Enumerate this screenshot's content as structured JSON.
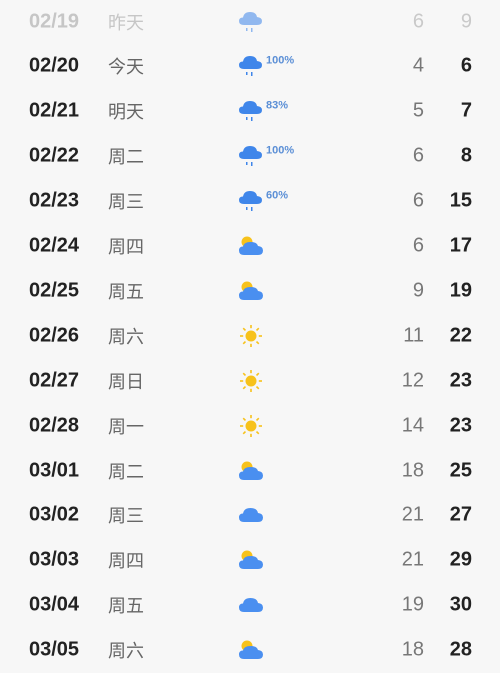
{
  "colors": {
    "rain_cloud": "#3f86ea",
    "cloud": "#4a8ff0",
    "sun": "#f7c21b",
    "precip_text": "#5b8fd6"
  },
  "forecast": [
    {
      "date": "02/19",
      "day": "昨天",
      "icon": "rain-icon",
      "precip": "",
      "low": "6",
      "high": "9",
      "past": true
    },
    {
      "date": "02/20",
      "day": "今天",
      "icon": "rain-icon",
      "precip": "100%",
      "low": "4",
      "high": "6",
      "past": false
    },
    {
      "date": "02/21",
      "day": "明天",
      "icon": "rain-icon",
      "precip": "83%",
      "low": "5",
      "high": "7",
      "past": false
    },
    {
      "date": "02/22",
      "day": "周二",
      "icon": "rain-icon",
      "precip": "100%",
      "low": "6",
      "high": "8",
      "past": false
    },
    {
      "date": "02/23",
      "day": "周三",
      "icon": "rain-icon",
      "precip": "60%",
      "low": "6",
      "high": "15",
      "past": false
    },
    {
      "date": "02/24",
      "day": "周四",
      "icon": "partly-cloudy-icon",
      "precip": "",
      "low": "6",
      "high": "17",
      "past": false
    },
    {
      "date": "02/25",
      "day": "周五",
      "icon": "partly-cloudy-icon",
      "precip": "",
      "low": "9",
      "high": "19",
      "past": false
    },
    {
      "date": "02/26",
      "day": "周六",
      "icon": "sun-icon",
      "precip": "",
      "low": "11",
      "high": "22",
      "past": false
    },
    {
      "date": "02/27",
      "day": "周日",
      "icon": "sun-icon",
      "precip": "",
      "low": "12",
      "high": "23",
      "past": false
    },
    {
      "date": "02/28",
      "day": "周一",
      "icon": "sun-icon",
      "precip": "",
      "low": "14",
      "high": "23",
      "past": false
    },
    {
      "date": "03/01",
      "day": "周二",
      "icon": "partly-cloudy-icon",
      "precip": "",
      "low": "18",
      "high": "25",
      "past": false
    },
    {
      "date": "03/02",
      "day": "周三",
      "icon": "cloud-icon",
      "precip": "",
      "low": "21",
      "high": "27",
      "past": false
    },
    {
      "date": "03/03",
      "day": "周四",
      "icon": "partly-cloudy-icon",
      "precip": "",
      "low": "21",
      "high": "29",
      "past": false
    },
    {
      "date": "03/04",
      "day": "周五",
      "icon": "cloud-icon",
      "precip": "",
      "low": "19",
      "high": "30",
      "past": false
    },
    {
      "date": "03/05",
      "day": "周六",
      "icon": "partly-cloudy-icon",
      "precip": "",
      "low": "18",
      "high": "28",
      "past": false
    }
  ]
}
